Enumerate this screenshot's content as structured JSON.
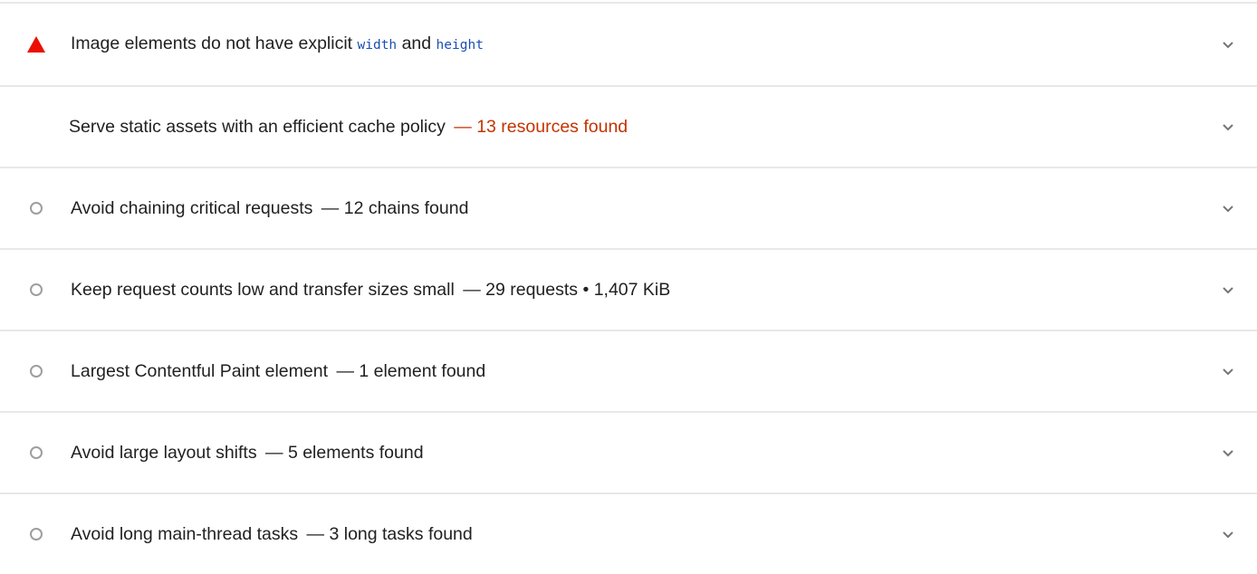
{
  "audits": [
    {
      "status": "fail",
      "status_icon": "red-triangle-icon",
      "title_parts": {
        "pre": "Image elements do not have explicit ",
        "code1": "width",
        "mid": " and ",
        "code2": "height"
      }
    },
    {
      "status": "average",
      "title": "Serve static assets with an efficient cache policy",
      "separator": "—",
      "display_value": "13 resources found",
      "display_color": "#c33300"
    },
    {
      "status": "informative",
      "title": "Avoid chaining critical requests",
      "separator": "—",
      "display_value": "12 chains found"
    },
    {
      "status": "informative",
      "title": "Keep request counts low and transfer sizes small",
      "separator": "—",
      "display_value": "29 requests • 1,407 KiB"
    },
    {
      "status": "informative",
      "title": "Largest Contentful Paint element",
      "separator": "—",
      "display_value": "1 element found"
    },
    {
      "status": "informative",
      "title": "Avoid large layout shifts",
      "separator": "—",
      "display_value": "5 elements found"
    },
    {
      "status": "informative",
      "title": "Avoid long main-thread tasks",
      "separator": "—",
      "display_value": "3 long tasks found"
    }
  ],
  "icons": {
    "fail": "red-triangle-icon",
    "informative": "circle-icon",
    "expand": "chevron-down-icon"
  },
  "colors": {
    "fail": "#eb3a33",
    "warn_text": "#c33300",
    "circle": "#9e9e9e",
    "code": "#1a4fb3",
    "divider": "#e8e8e8"
  }
}
